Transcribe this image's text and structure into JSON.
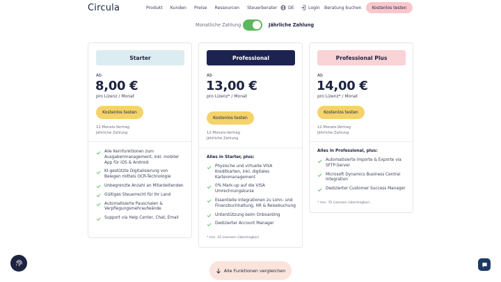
{
  "header": {
    "logo": "Circula",
    "nav": [
      "Produkt",
      "Kunden",
      "Preise",
      "Ressourcen",
      "Steuerberater"
    ],
    "lang": "DE",
    "login": "Login",
    "consult": "Beratung buchen",
    "cta": "Kostenlos testen"
  },
  "billing": {
    "monthly": "Monatliche Zahlung",
    "yearly": "Jährliche Zahlung",
    "toggle_on": true
  },
  "plans": [
    {
      "name": "Starter",
      "ab": "Ab",
      "price": "8,00 €",
      "per": "pro Lizenz / Monat",
      "cta": "Kostenlos testen",
      "contract": "12-Monats-Vertrag",
      "payment": "Jährliche Zahlung",
      "header": "",
      "features": [
        "Alle Kernfunktionen zum Ausgabenmanagement, inkl. mobiler App für iOS & Android",
        "KI-gestützte Digitalisierung von Belegen mittels OCR-Technologie",
        "Unbegrenzte Anzahl an Mitarbeitenden",
        "Gültiges Steuerrecht für Ihr Land",
        "Automatisierte Pauschalen & Verpflegungsmehraufwände",
        "Support via Help Center, Chat, Email"
      ],
      "note": "",
      "title_bg": "#dcedf1",
      "title_color": "#1d2340"
    },
    {
      "name": "Professional",
      "ab": "Ab",
      "price": "13,00 €",
      "per": "pro Lizenz* / Monat",
      "cta": "Kostenlos testen",
      "contract": "12-Monats-Vertrag",
      "payment": "Jährliche Zahlung",
      "header": "Alles in Starter, plus:",
      "features": [
        "Physische und virtuelle VISA Kreditkarten, inkl. digitales Kartenmanagement",
        "0% Mark-up auf die VISA Umrechnungskurse",
        "Essentielle Integrationen zu Lohn- und Finanzbuchhaltung, HR & Reisebuchung",
        "Unterstützung beim Onboarding",
        "Dedizierter Account Manager"
      ],
      "note": "* min. 10 Lizenzen (übertragbar)",
      "title_bg": "#1d2350",
      "title_color": "#ffffff"
    },
    {
      "name": "Professional Plus",
      "ab": "Ab",
      "price": "14,00 €",
      "per": "pro Lizenz* / Monat",
      "cta": "Kostenlos testen",
      "contract": "12-Monats-Vertrag",
      "payment": "Jährliche Zahlung",
      "header": "Alles in Professional, plus:",
      "features": [
        "Automatisierte Importe & Exporte via SFTP-Server",
        "Microsoft Dynamics Business Central Integration",
        "Dedizierter Customer Success Manager"
      ],
      "note": "* min. 70 Lizenzen (übertragbar)",
      "title_bg": "#f9d3d6",
      "title_color": "#1d2340"
    }
  ],
  "compare": "Alle Funktionen vergleichen",
  "colors": {
    "accent_green": "#5cb85c",
    "cta_yellow": "#f5d36a",
    "navy": "#1d2350"
  },
  "icons": [
    "globe-icon",
    "login-icon",
    "check-icon",
    "arrow-down-icon",
    "fingerprint-icon",
    "chat-icon"
  ]
}
